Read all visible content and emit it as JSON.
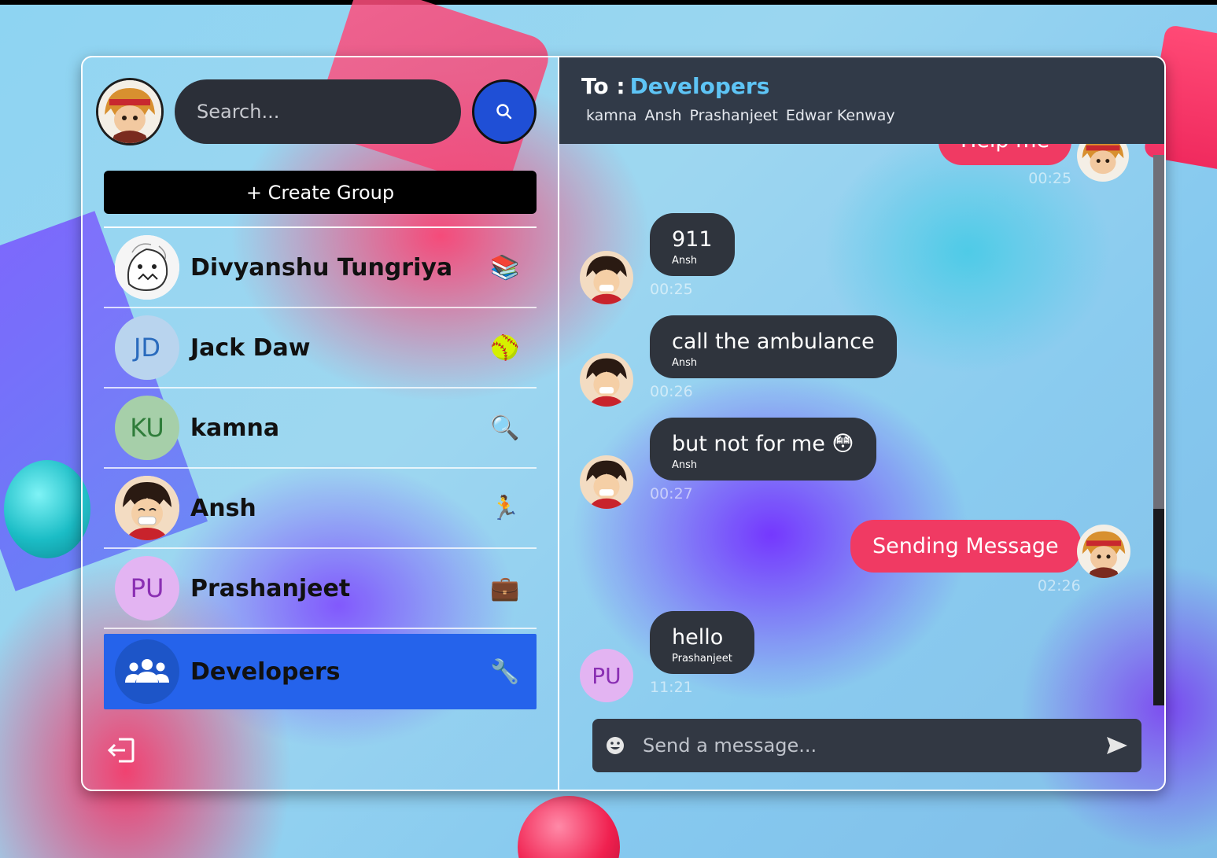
{
  "search": {
    "placeholder": "Search..."
  },
  "sidebar": {
    "create_group_label": "+ Create Group",
    "chats": [
      {
        "name": "Divyanshu Tungriya",
        "avatar_type": "image",
        "emoji": "📚"
      },
      {
        "name": "Jack Daw",
        "initials": "JD",
        "avatar_color": "#b9d4ee",
        "initials_color": "#2a6bbd",
        "emoji": "🥎"
      },
      {
        "name": "kamna",
        "initials": "KU",
        "avatar_color": "#a6cfa9",
        "initials_color": "#2f7d3a",
        "emoji": "🔍"
      },
      {
        "name": "Ansh",
        "avatar_type": "image",
        "emoji": "🏃"
      },
      {
        "name": "Prashanjeet",
        "initials": "PU",
        "avatar_color": "#e3b4f2",
        "initials_color": "#8a2fb3",
        "emoji": "💼"
      },
      {
        "name": "Developers",
        "avatar_type": "group-icon",
        "emoji": "🔧",
        "active": true
      }
    ]
  },
  "header": {
    "to_label": "To :",
    "group_name": "Developers",
    "members": [
      "kamna",
      "Ansh",
      "Prashanjeet",
      "Edwar Kenway"
    ]
  },
  "messages": [
    {
      "direction": "out",
      "text": "Help me",
      "time": "00:25"
    },
    {
      "direction": "in",
      "text": "911",
      "sender": "Ansh",
      "time": "00:25"
    },
    {
      "direction": "in",
      "text": "call the ambulance",
      "sender": "Ansh",
      "time": "00:26"
    },
    {
      "direction": "in",
      "text": "but not for me 😳",
      "sender": "Ansh",
      "time": "00:27"
    },
    {
      "direction": "out",
      "text": "Sending Message",
      "time": "02:26"
    },
    {
      "direction": "in",
      "text": "hello",
      "sender": "Prashanjeet",
      "sender_initials": "PU",
      "time": "11:21"
    }
  ],
  "composer": {
    "placeholder": "Send a message..."
  },
  "colors": {
    "accent_blue": "#2563eb",
    "outgoing_bubble": "#f03a63",
    "incoming_bubble": "#2f343d",
    "header_bg": "#313a48",
    "group_name": "#5ec4f5"
  }
}
